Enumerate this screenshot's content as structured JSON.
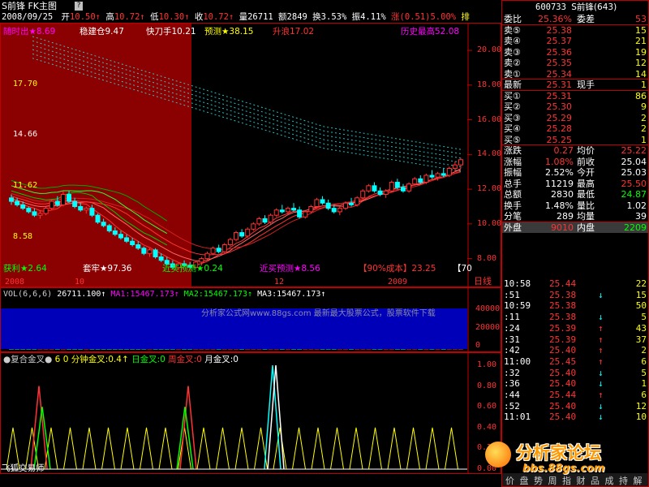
{
  "title": {
    "name": "S前锋",
    "chart_label": "FK主图",
    "tip": "?",
    "date": "2008/09/25",
    "open_label": "开",
    "open": "10.50",
    "high_label": "高",
    "high": "10.72",
    "low_label": "低",
    "low": "10.30",
    "close_label": "收",
    "close": "10.72",
    "vol_label": "量",
    "vol": "26711",
    "amount_label": "额",
    "amount": "2849",
    "turnover_label": "换",
    "turnover": "3.53%",
    "amplitude_label": "振",
    "amplitude": "4.11%",
    "change_label": "涨",
    "change": "(0.51)",
    "change_pct": "5.00%",
    "right_mark": "排"
  },
  "indicators_row1": [
    {
      "label": "随时出★",
      "value": "8.69",
      "color": "#ff00ff"
    },
    {
      "label": "稳建仓",
      "value": "9.47",
      "color": "#ffffff"
    },
    {
      "label": "快刀手",
      "value": "10.21",
      "color": "#ffffff"
    },
    {
      "label": "预测★",
      "value": "38.15",
      "color": "#ffff00"
    },
    {
      "label": "升浪",
      "value": "17.02",
      "color": "#ff3333"
    },
    {
      "label": "历史最高",
      "value": "52.08",
      "color": "#ff00ff"
    }
  ],
  "indicators_bottom": [
    {
      "label": "获利★",
      "value": "2.64",
      "color": "#00ff00"
    },
    {
      "label": "套牢★",
      "value": "97.36",
      "color": "#ffffff"
    },
    {
      "label": "近买预测★",
      "value": "0.24",
      "color": "#00ff00"
    },
    {
      "label": "近买预测★",
      "value": "8.56",
      "color": "#ff00ff"
    },
    {
      "label": "【90%成本】",
      "value": "23.25",
      "color": "#ff3333"
    },
    {
      "label": "【",
      "value": "70",
      "color": "#ffffff"
    }
  ],
  "main_chart": {
    "left_ticks": [
      "17.70",
      "14.66",
      "11.62",
      "8.58"
    ],
    "right_ticks": [
      "20.00",
      "18.00",
      "16.00",
      "14.00",
      "12.00",
      "10.00",
      "8.00"
    ],
    "x_labels": [
      "2008",
      "10",
      "12",
      "2009"
    ],
    "period": "日线"
  },
  "chart_data": {
    "type": "candlestick",
    "xlabel": "",
    "ylabel": "",
    "ylim": [
      7,
      21.5
    ],
    "x_labels": [
      "2008",
      "10",
      "12",
      "2009"
    ],
    "candles": [
      [
        11.5,
        11.7,
        11.1,
        11.3
      ],
      [
        11.3,
        11.5,
        11.0,
        11.1
      ],
      [
        11.1,
        11.3,
        10.8,
        10.9
      ],
      [
        10.9,
        11.0,
        10.6,
        10.7
      ],
      [
        10.7,
        10.9,
        10.4,
        10.5
      ],
      [
        10.5,
        10.8,
        10.3,
        10.6
      ],
      [
        10.6,
        11.0,
        10.5,
        10.9
      ],
      [
        10.9,
        11.4,
        10.8,
        11.3
      ],
      [
        11.3,
        11.6,
        11.0,
        11.1
      ],
      [
        11.1,
        11.9,
        11.0,
        11.7
      ],
      [
        11.7,
        11.9,
        11.2,
        11.3
      ],
      [
        11.3,
        11.5,
        10.9,
        11.0
      ],
      [
        11.0,
        11.2,
        10.7,
        10.8
      ],
      [
        10.8,
        11.0,
        10.6,
        10.9
      ],
      [
        10.9,
        11.1,
        10.4,
        10.5
      ],
      [
        10.5,
        10.6,
        10.0,
        10.1
      ],
      [
        10.1,
        10.3,
        9.8,
        9.9
      ],
      [
        9.9,
        10.0,
        9.5,
        9.6
      ],
      [
        9.6,
        9.8,
        9.3,
        9.4
      ],
      [
        9.4,
        9.6,
        9.1,
        9.2
      ],
      [
        9.2,
        9.4,
        8.9,
        9.0
      ],
      [
        9.0,
        9.2,
        8.7,
        8.8
      ],
      [
        8.8,
        9.0,
        8.5,
        8.6
      ],
      [
        8.6,
        8.7,
        8.2,
        8.3
      ],
      [
        8.3,
        8.6,
        8.1,
        8.5
      ],
      [
        8.5,
        8.6,
        8.0,
        8.1
      ],
      [
        8.1,
        8.3,
        7.8,
        7.9
      ],
      [
        7.9,
        8.1,
        7.6,
        7.7
      ],
      [
        7.7,
        7.9,
        7.4,
        7.5
      ],
      [
        7.5,
        7.8,
        7.4,
        7.7
      ],
      [
        7.7,
        7.9,
        7.5,
        7.6
      ],
      [
        7.6,
        7.8,
        7.4,
        7.5
      ],
      [
        7.5,
        7.9,
        7.4,
        7.8
      ],
      [
        7.8,
        8.1,
        7.6,
        8.0
      ],
      [
        8.0,
        8.4,
        7.9,
        8.3
      ],
      [
        8.3,
        8.7,
        8.2,
        8.6
      ],
      [
        8.6,
        8.8,
        8.3,
        8.4
      ],
      [
        8.4,
        8.9,
        8.3,
        8.8
      ],
      [
        8.8,
        9.2,
        8.7,
        9.1
      ],
      [
        9.1,
        9.6,
        9.0,
        9.5
      ],
      [
        9.5,
        9.7,
        9.2,
        9.3
      ],
      [
        9.3,
        9.8,
        9.2,
        9.7
      ],
      [
        9.7,
        10.1,
        9.6,
        10.0
      ],
      [
        10.0,
        10.4,
        9.9,
        10.3
      ],
      [
        10.3,
        10.5,
        10.0,
        10.1
      ],
      [
        10.1,
        10.6,
        10.0,
        10.5
      ],
      [
        10.5,
        10.9,
        10.4,
        10.8
      ],
      [
        10.8,
        11.1,
        10.6,
        10.7
      ],
      [
        10.7,
        11.0,
        10.5,
        10.9
      ],
      [
        10.9,
        11.2,
        10.7,
        10.8
      ],
      [
        10.8,
        11.0,
        10.3,
        10.4
      ],
      [
        10.4,
        10.8,
        10.3,
        10.7
      ],
      [
        10.7,
        11.1,
        10.6,
        11.0
      ],
      [
        11.0,
        11.5,
        10.9,
        11.4
      ],
      [
        11.4,
        11.6,
        11.1,
        11.2
      ],
      [
        11.2,
        11.4,
        10.8,
        10.9
      ],
      [
        10.9,
        11.1,
        10.6,
        10.7
      ],
      [
        10.7,
        11.0,
        10.5,
        10.9
      ],
      [
        10.9,
        11.3,
        10.8,
        11.2
      ],
      [
        11.2,
        11.5,
        11.0,
        11.1
      ],
      [
        11.1,
        11.6,
        11.0,
        11.5
      ],
      [
        11.5,
        12.0,
        11.4,
        11.9
      ],
      [
        11.9,
        12.3,
        11.8,
        12.2
      ],
      [
        12.2,
        12.4,
        11.8,
        11.9
      ],
      [
        11.9,
        12.1,
        11.6,
        11.7
      ],
      [
        11.7,
        12.0,
        11.5,
        11.9
      ],
      [
        11.9,
        12.5,
        11.8,
        12.4
      ],
      [
        12.4,
        12.6,
        12.0,
        12.1
      ],
      [
        12.1,
        12.3,
        11.8,
        11.9
      ],
      [
        11.9,
        12.4,
        11.8,
        12.3
      ],
      [
        12.3,
        12.7,
        12.2,
        12.6
      ],
      [
        12.6,
        12.8,
        12.3,
        12.4
      ],
      [
        12.4,
        12.9,
        12.3,
        12.8
      ],
      [
        12.8,
        13.1,
        12.6,
        12.7
      ],
      [
        12.7,
        13.0,
        12.5,
        12.9
      ],
      [
        12.9,
        13.2,
        12.7,
        12.8
      ],
      [
        12.8,
        13.3,
        12.7,
        13.2
      ],
      [
        13.2,
        13.6,
        13.0,
        13.4
      ],
      [
        13.4,
        13.8,
        13.2,
        13.7
      ]
    ]
  },
  "vol_panel": {
    "header": [
      {
        "text": "VOL(6,6,6)",
        "color": "#cccccc"
      },
      {
        "text": "26711.100↑",
        "color": "#ffffff"
      },
      {
        "text": "MA1:15467.173↑",
        "color": "#ff00ff"
      },
      {
        "text": "MA2:15467.173↑",
        "color": "#00ff00"
      },
      {
        "text": "MA3:15467.173↑",
        "color": "#ffffff"
      }
    ],
    "watermark": "分析家公式网www.88gs.com 最新最大股票公式，股票软件下载",
    "ticks": [
      "40000",
      "20000",
      "0"
    ]
  },
  "sub_panel": {
    "header": [
      {
        "text": "●复合金叉●",
        "color": "#cccccc"
      },
      {
        "text": "6 0 分钟金叉:0.4↑",
        "color": "#ffff00"
      },
      {
        "text": "日金叉:0",
        "color": "#00ff00"
      },
      {
        "text": "周金叉:0",
        "color": "#ff3333"
      },
      {
        "text": "月金叉:0",
        "color": "#ffffff"
      }
    ],
    "ticks": [
      "1.00",
      "0.80",
      "0.60",
      "0.40",
      "0.20",
      "0.00"
    ],
    "footer": "飞狐交易师"
  },
  "quote": {
    "code": "600733",
    "name": "S前锋(643)",
    "ratio_label": "委比",
    "ratio": "25.36%",
    "diff_label": "委差",
    "diff": "53",
    "asks": [
      {
        "label": "卖⑤",
        "price": "25.38",
        "vol": "15"
      },
      {
        "label": "卖④",
        "price": "25.37",
        "vol": "21"
      },
      {
        "label": "卖③",
        "price": "25.36",
        "vol": "19"
      },
      {
        "label": "卖②",
        "price": "25.35",
        "vol": "12"
      },
      {
        "label": "卖①",
        "price": "25.34",
        "vol": "14"
      }
    ],
    "last_label": "最新",
    "last": "25.31",
    "hand_label": "现手",
    "hand": "1",
    "bids": [
      {
        "label": "买①",
        "price": "25.31",
        "vol": "86"
      },
      {
        "label": "买②",
        "price": "25.30",
        "vol": "9"
      },
      {
        "label": "买③",
        "price": "25.29",
        "vol": "2"
      },
      {
        "label": "买④",
        "price": "25.28",
        "vol": "2"
      },
      {
        "label": "买⑤",
        "price": "25.25",
        "vol": "1"
      }
    ],
    "stats": [
      {
        "l1": "涨跌",
        "v1": "0.27",
        "c1": "#ff3333",
        "l2": "均价",
        "v2": "25.22",
        "c2": "#ff3333"
      },
      {
        "l1": "涨幅",
        "v1": "1.08%",
        "c1": "#ff3333",
        "l2": "前收",
        "v2": "25.04",
        "c2": "#ffffff"
      },
      {
        "l1": "振幅",
        "v1": "2.52%",
        "c1": "#ffffff",
        "l2": "今开",
        "v2": "25.03",
        "c2": "#ffffff"
      },
      {
        "l1": "总手",
        "v1": "11219",
        "c1": "#ffffff",
        "l2": "最高",
        "v2": "25.50",
        "c2": "#ff3333"
      },
      {
        "l1": "总额",
        "v1": "2830",
        "c1": "#ffffff",
        "l2": "最低",
        "v2": "24.87",
        "c2": "#00ff00"
      },
      {
        "l1": "换手",
        "v1": "1.48%",
        "c1": "#ffffff",
        "l2": "量比",
        "v2": "1.02",
        "c2": "#ffffff"
      },
      {
        "l1": "分笔",
        "v1": "289",
        "c1": "#ffffff",
        "l2": "均量",
        "v2": "39",
        "c2": "#ffffff"
      }
    ],
    "outer_label": "外盘",
    "outer": "9010",
    "inner_label": "内盘",
    "inner": "2209",
    "ticks": [
      {
        "t": "10:58",
        "p": "25.44",
        "a": "",
        "v": "22",
        "c": "#ff3333"
      },
      {
        "t": ":51",
        "p": "25.38",
        "a": "↓",
        "v": "15",
        "c": "#00ffff"
      },
      {
        "t": "10:59",
        "p": "25.38",
        "a": "",
        "v": "50",
        "c": "#ff3333"
      },
      {
        "t": ":11",
        "p": "25.38",
        "a": "↓",
        "v": "5",
        "c": "#00ffff"
      },
      {
        "t": ":24",
        "p": "25.39",
        "a": "↑",
        "v": "43",
        "c": "#ff3333"
      },
      {
        "t": ":31",
        "p": "25.39",
        "a": "↑",
        "v": "37",
        "c": "#ff3333"
      },
      {
        "t": ":42",
        "p": "25.40",
        "a": "↑",
        "v": "2",
        "c": "#ff3333"
      },
      {
        "t": "11:00",
        "p": "25.45",
        "a": "↑",
        "v": "6",
        "c": "#ff3333"
      },
      {
        "t": ":32",
        "p": "25.40",
        "a": "↓",
        "v": "5",
        "c": "#00ffff"
      },
      {
        "t": ":36",
        "p": "25.40",
        "a": "↓",
        "v": "1",
        "c": "#00ffff"
      },
      {
        "t": ":44",
        "p": "25.44",
        "a": "↑",
        "v": "6",
        "c": "#ff3333"
      },
      {
        "t": ":52",
        "p": "25.40",
        "a": "↓",
        "v": "12",
        "c": "#00ffff"
      },
      {
        "t": "11:01",
        "p": "25.40",
        "a": "↓",
        "v": "10",
        "c": "#00ffff"
      }
    ],
    "bottom_tabs": [
      "价",
      "盘",
      "势",
      "周",
      "指",
      "财",
      "品",
      "成",
      "持",
      "解"
    ]
  },
  "logo": {
    "line1": "分析家论坛",
    "line2": "bbs.88gs.com"
  }
}
